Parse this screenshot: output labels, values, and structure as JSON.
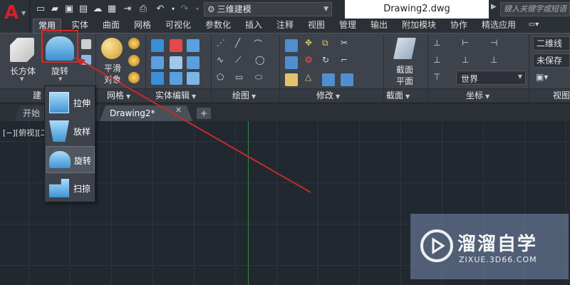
{
  "titlebar": {
    "app_letter": "A",
    "workspace": "三维建模",
    "document_title": "Drawing2.dwg",
    "search_placeholder": "键入关键字或短语"
  },
  "ribbon_tabs": [
    "常用",
    "实体",
    "曲面",
    "网格",
    "可视化",
    "参数化",
    "插入",
    "注释",
    "视图",
    "管理",
    "输出",
    "附加模块",
    "协作",
    "精选应用"
  ],
  "active_tab": "常用",
  "ribbon": {
    "box_label": "长方体",
    "revolve_label": "旋转",
    "smooth_label_line1": "平滑",
    "smooth_label_line2": "对象",
    "section_label_line1": "截面",
    "section_label_line2": "平面",
    "world_label": "世界",
    "visual_style_1": "二维线",
    "visual_style_2": "未保存",
    "panels": {
      "modeling": "建",
      "mesh": "网格",
      "solid_edit": "实体编辑",
      "draw": "绘图",
      "modify": "修改",
      "section": "截面",
      "coordinates": "坐标",
      "view": "视图"
    }
  },
  "file_tabs": {
    "start": "开始",
    "document": "Drawing2*"
  },
  "viewport_label": "[−][俯视][二",
  "dropdown_items": [
    {
      "label": "拉伸",
      "icon": "extrude-icon"
    },
    {
      "label": "放样",
      "icon": "loft-icon"
    },
    {
      "label": "旋转",
      "icon": "revolve-icon"
    },
    {
      "label": "扫掠",
      "icon": "sweep-icon"
    }
  ],
  "watermark": {
    "title": "溜溜自学",
    "url": "ZIXUE.3D66.COM"
  },
  "colors": {
    "accent_red": "#d22b2b",
    "ribbon_bg": "#3d424b",
    "canvas_bg": "#212830",
    "y_axis": "#2e8b3a"
  }
}
